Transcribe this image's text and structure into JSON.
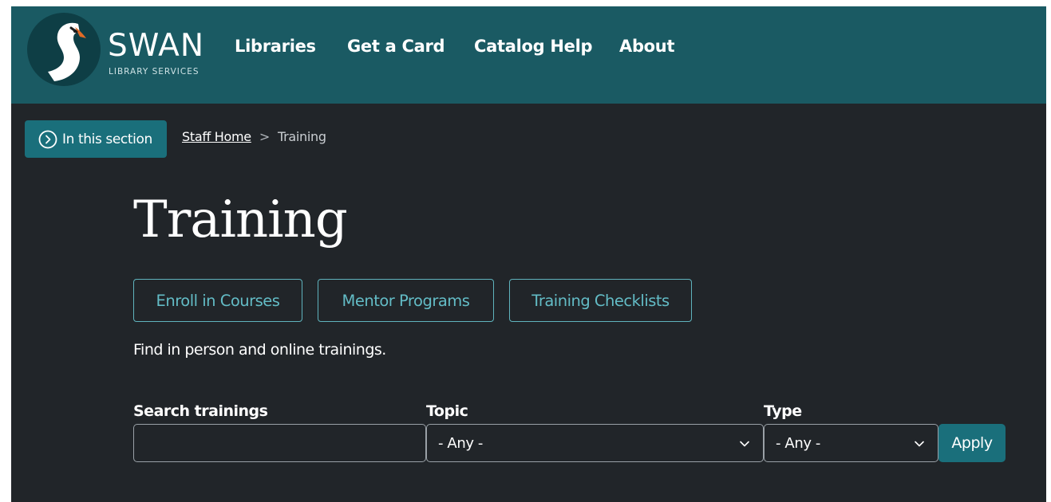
{
  "brand": {
    "name": "SWAN",
    "subtitle": "LIBRARY SERVICES",
    "colors": {
      "header": "#1a5a63",
      "accent": "#1a6f7b",
      "page_bg": "#212529",
      "link": "#63bcc6"
    }
  },
  "nav": {
    "items": [
      {
        "label": "Libraries"
      },
      {
        "label": "Get a Card"
      },
      {
        "label": "Catalog Help"
      },
      {
        "label": "About"
      }
    ]
  },
  "section_menu": {
    "label": "In this section",
    "icon": "chevron-right-circle-icon"
  },
  "breadcrumb": {
    "home": "Staff Home",
    "separator": ">",
    "current": "Training"
  },
  "page": {
    "title": "Training",
    "buttons": [
      {
        "label": "Enroll in Courses"
      },
      {
        "label": "Mentor Programs"
      },
      {
        "label": "Training Checklists"
      }
    ],
    "intro": "Find in person and online trainings."
  },
  "filters": {
    "search": {
      "label": "Search trainings",
      "value": ""
    },
    "topic": {
      "label": "Topic",
      "selected": "- Any -"
    },
    "type": {
      "label": "Type",
      "selected": "- Any -"
    },
    "apply_label": "Apply"
  }
}
